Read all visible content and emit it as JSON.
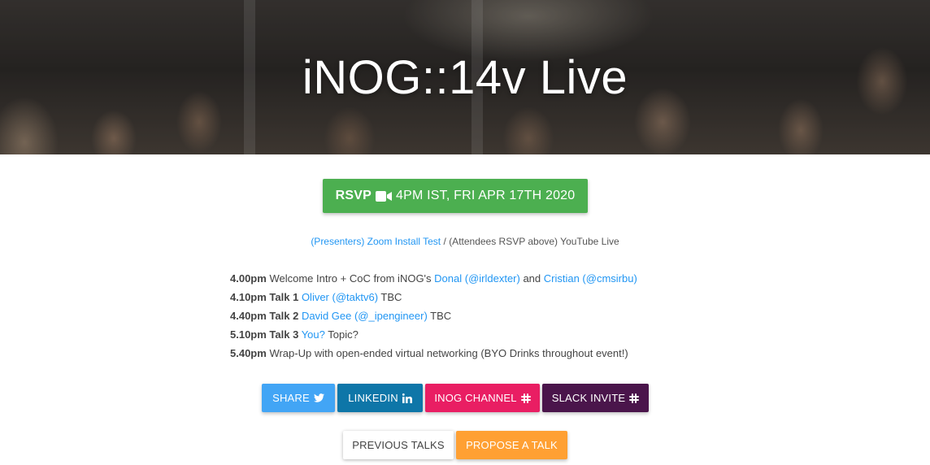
{
  "hero": {
    "title": "iNOG::14v Live"
  },
  "rsvp": {
    "label": "RSVP",
    "text": "4PM IST, FRI APR 17TH 2020",
    "icon": "video-camera-icon",
    "color": "#4caf50"
  },
  "links": {
    "presenters": "(Presenters) Zoom Install Test",
    "separator": "/",
    "attendees": "(Attendees RSVP above) YouTube Live"
  },
  "agenda": [
    {
      "time": "4.00pm",
      "parts": [
        {
          "text": "Welcome Intro + CoC from iNOG's ",
          "link": false
        },
        {
          "text": "Donal (@irldexter)",
          "link": true
        },
        {
          "text": " and ",
          "link": false
        },
        {
          "text": "Cristian (@cmsirbu)",
          "link": true
        }
      ]
    },
    {
      "time": "4.10pm Talk 1",
      "parts": [
        {
          "text": "Oliver (@taktv6)",
          "link": true
        },
        {
          "text": " TBC",
          "link": false
        }
      ]
    },
    {
      "time": "4.40pm Talk 2",
      "parts": [
        {
          "text": "David Gee (@_ipengineer)",
          "link": true
        },
        {
          "text": " TBC",
          "link": false
        }
      ]
    },
    {
      "time": "5.10pm Talk 3",
      "parts": [
        {
          "text": "You?",
          "link": true
        },
        {
          "text": " Topic?",
          "link": false
        }
      ]
    },
    {
      "time": "5.40pm",
      "parts": [
        {
          "text": "Wrap-Up with open-ended virtual networking (BYO Drinks throughout event!)",
          "link": false
        }
      ]
    }
  ],
  "buttons": {
    "share": {
      "label": "SHARE",
      "icon": "twitter-icon",
      "color": "#42a5f5"
    },
    "linkedin": {
      "label": "LINKEDIN",
      "icon": "linkedin-icon",
      "color": "#0e76a8"
    },
    "channel": {
      "label": "INOG CHANNEL",
      "icon": "slack-icon",
      "color": "#e91e63"
    },
    "slack": {
      "label": "SLACK INVITE",
      "icon": "slack-icon",
      "color": "#4a154b"
    },
    "previous": {
      "label": "PREVIOUS TALKS"
    },
    "propose": {
      "label": "PROPOSE A TALK",
      "color": "#ffa033"
    }
  }
}
